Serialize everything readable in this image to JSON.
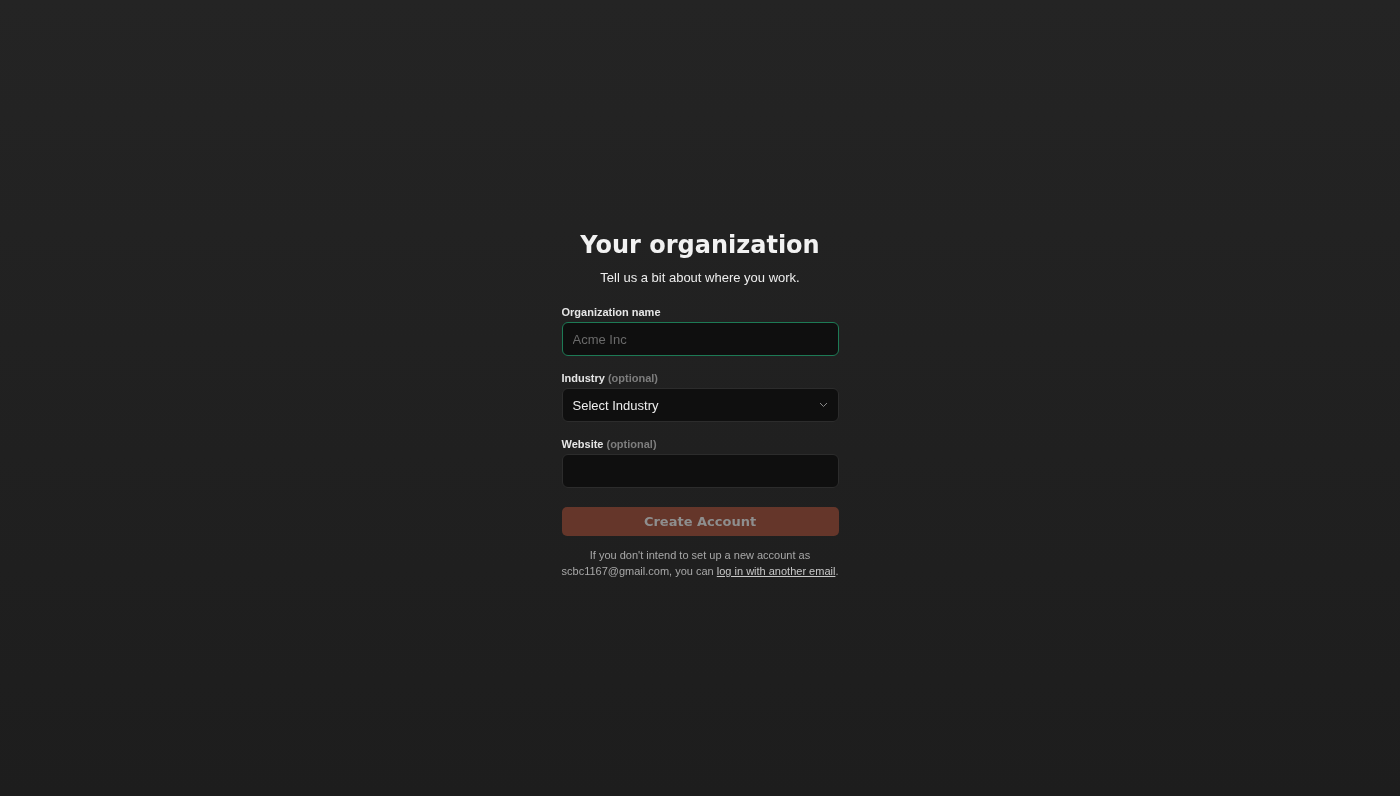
{
  "title": "Your organization",
  "subtitle": "Tell us a bit about where you work.",
  "fields": [
    {
      "kind": "input",
      "label": "Organization name",
      "placeholder": "Acme Inc",
      "focused": true
    },
    {
      "kind": "select",
      "label": "Industry",
      "optional_note": "(optional)",
      "value": "Select Industry",
      "focused": false
    },
    {
      "kind": "input",
      "label": "Website",
      "optional_note": "(optional)",
      "focused": false
    }
  ],
  "submit": {
    "label": "Create Account",
    "disabled": true
  },
  "note": {
    "text": "If you don't intend to set up a new account as scbc1167@gmail.com, you can",
    "link": "log in with another email",
    "after": "."
  }
}
